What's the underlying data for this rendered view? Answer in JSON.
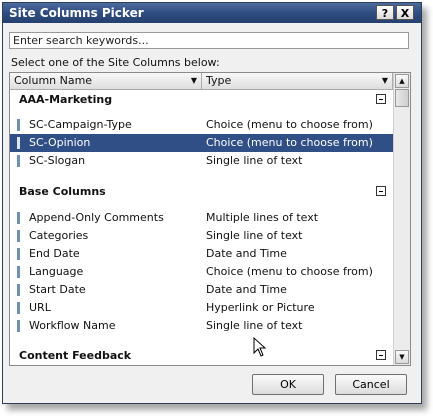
{
  "window": {
    "title": "Site Columns Picker",
    "help_icon": "?",
    "close_icon": "X"
  },
  "search": {
    "placeholder": "Enter search keywords..."
  },
  "instruction": "Select one of the Site Columns below:",
  "grid": {
    "columns": [
      "Column Name",
      "Type"
    ],
    "groups": [
      {
        "name": "AAA-Marketing",
        "rows": [
          {
            "name": "SC-Campaign-Type",
            "type": "Choice (menu to choose from)"
          },
          {
            "name": "SC-Opinion",
            "type": "Choice (menu to choose from)",
            "selected": true
          },
          {
            "name": "SC-Slogan",
            "type": "Single line of text"
          }
        ]
      },
      {
        "name": "Base Columns",
        "rows": [
          {
            "name": "Append-Only Comments",
            "type": "Multiple lines of text"
          },
          {
            "name": "Categories",
            "type": "Single line of text"
          },
          {
            "name": "End Date",
            "type": "Date and Time"
          },
          {
            "name": "Language",
            "type": "Choice (menu to choose from)"
          },
          {
            "name": "Start Date",
            "type": "Date and Time"
          },
          {
            "name": "URL",
            "type": "Hyperlink or Picture"
          },
          {
            "name": "Workflow Name",
            "type": "Single line of text"
          }
        ]
      },
      {
        "name": "Content Feedback",
        "rows": []
      }
    ]
  },
  "buttons": {
    "ok": "OK",
    "cancel": "Cancel"
  },
  "colors": {
    "title_bar": "#2f4d80",
    "selection": "#2f4f86"
  }
}
